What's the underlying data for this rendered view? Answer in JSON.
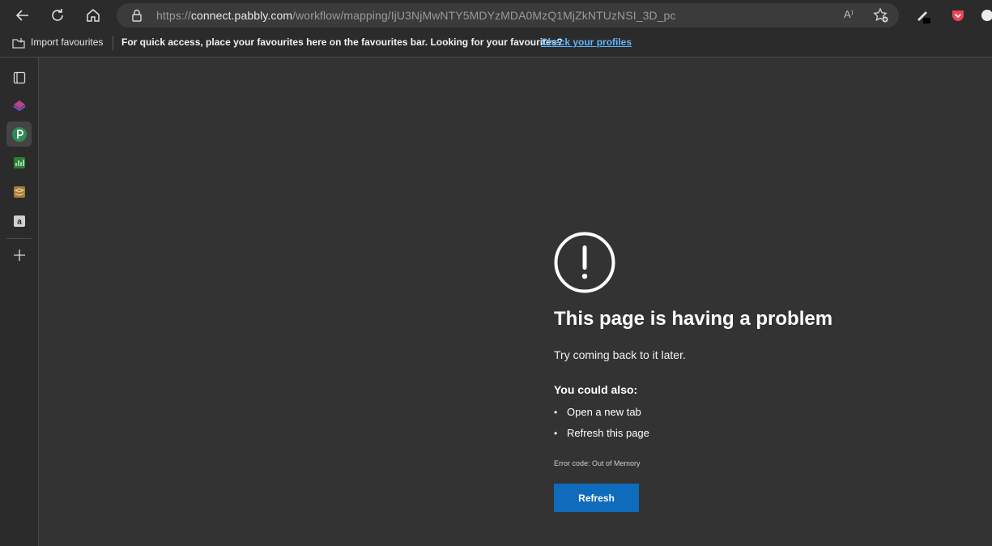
{
  "browser": {
    "url": {
      "scheme": "https://",
      "host": "connect.pabbly.com",
      "path": "/workflow/mapping/IjU3NjMwNTY5MDYzMDA0MzQ1MjZkNTUzNSI_3D_pc"
    },
    "read_aloud_glyph": "A⁾",
    "favourites_bar": {
      "import_label": "Import favourites",
      "message": "For quick access, place your favourites here on the favourites bar. Looking for your favourites?",
      "link_label": "Check your profiles"
    }
  },
  "error_page": {
    "title": "This page is having a problem",
    "subtitle": "Try coming back to it later.",
    "also_heading": "You could also:",
    "suggestions": [
      "Open a new tab",
      "Refresh this page"
    ],
    "error_code": "Error code: Out of Memory",
    "refresh_label": "Refresh",
    "accent_color": "#0f6cbd"
  },
  "sidebar_icons": [
    "tabs-icon",
    "layers-app-icon",
    "pabbly-icon",
    "analytics-icon",
    "stack-app-icon",
    "amazon-icon",
    "add-icon"
  ]
}
